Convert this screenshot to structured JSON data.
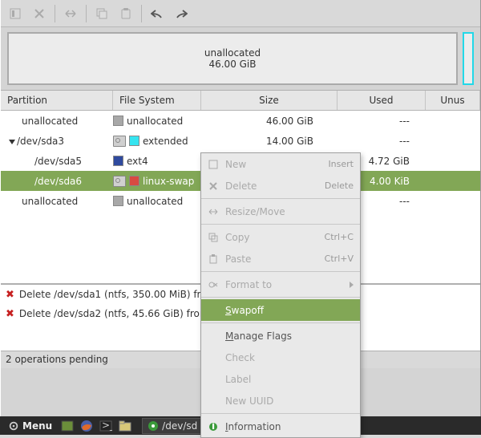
{
  "disk_overview": {
    "label": "unallocated",
    "size": "46.00 GiB"
  },
  "columns": {
    "partition": "Partition",
    "fs": "File System",
    "size": "Size",
    "used": "Used",
    "unused": "Unus"
  },
  "rows": [
    {
      "indent": 1,
      "name": "unallocated",
      "icon": null,
      "fs_color": "#a8a8a8",
      "fs": "unallocated",
      "size": "46.00 GiB",
      "used": "---",
      "unused": ""
    },
    {
      "indent": 0,
      "tri": true,
      "name": "/dev/sda3",
      "icon": true,
      "fs_color": "#35e4f0",
      "fs": "extended",
      "size": "14.00 GiB",
      "used": "---",
      "unused": ""
    },
    {
      "indent": 2,
      "name": "/dev/sda5",
      "icon": null,
      "fs_color": "#2f4a9e",
      "fs": "ext4",
      "size": "",
      "used": "4.72 GiB",
      "unused": ""
    },
    {
      "indent": 2,
      "name": "/dev/sda6",
      "icon": true,
      "fs_color": "#d84a42",
      "fs": "linux-swap",
      "size": "",
      "used": "4.00 KiB",
      "unused": "",
      "selected": true
    },
    {
      "indent": 1,
      "name": "unallocated",
      "icon": null,
      "fs_color": "#a8a8a8",
      "fs": "unallocated",
      "size": "",
      "used": "---",
      "unused": ""
    }
  ],
  "ops": [
    "Delete /dev/sda1 (ntfs, 350.00 MiB) fro",
    "Delete /dev/sda2 (ntfs, 45.66 GiB) fron"
  ],
  "status": "2 operations pending",
  "context_menu": [
    {
      "icon": "new",
      "label": "New",
      "accel": "Insert",
      "disabled": true
    },
    {
      "icon": "delete",
      "label": "Delete",
      "accel": "Delete",
      "disabled": true
    },
    {
      "sep": true
    },
    {
      "icon": "resize",
      "label": "Resize/Move",
      "disabled": true
    },
    {
      "sep": true
    },
    {
      "icon": "copy",
      "label": "Copy",
      "accel": "Ctrl+C",
      "disabled": true
    },
    {
      "icon": "paste",
      "label": "Paste",
      "accel": "Ctrl+V",
      "disabled": true
    },
    {
      "sep": true
    },
    {
      "icon": "format",
      "label": "Format to",
      "submenu": true,
      "disabled": true
    },
    {
      "sep": true
    },
    {
      "label": "Swapoff",
      "hover": true
    },
    {
      "sep": true
    },
    {
      "label": "Manage Flags",
      "underline": true
    },
    {
      "label": "Check",
      "disabled": true
    },
    {
      "label": "Label",
      "disabled": true
    },
    {
      "label": "New UUID",
      "disabled": true
    },
    {
      "sep": true
    },
    {
      "icon": "info",
      "label": "Information",
      "underline": true
    }
  ],
  "taskbar": {
    "menu": "Menu",
    "task": "/dev/sd"
  }
}
